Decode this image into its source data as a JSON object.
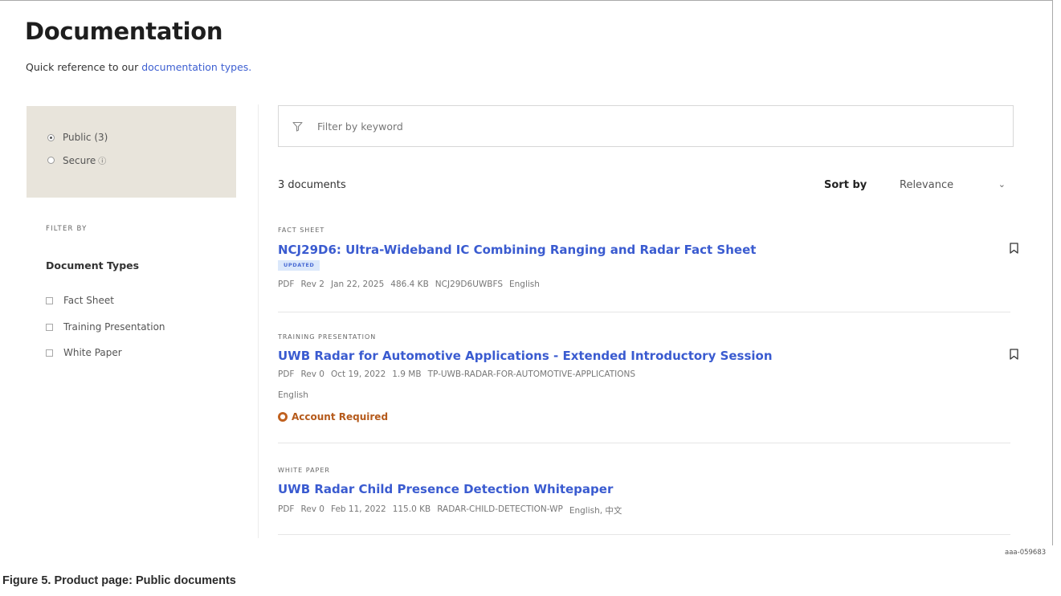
{
  "header": {
    "title": "Documentation",
    "intro_prefix": "Quick reference to our ",
    "intro_link": "documentation types."
  },
  "access": {
    "options": [
      {
        "label": "Public (3)",
        "selected": true
      },
      {
        "label": "Secure",
        "selected": false,
        "icon": "info-icon"
      }
    ]
  },
  "filters": {
    "filter_by_label": "FILTER BY",
    "doc_types_heading": "Document Types",
    "doc_types": [
      "Fact Sheet",
      "Training Presentation",
      "White Paper"
    ]
  },
  "search": {
    "placeholder": "Filter by keyword",
    "icon": "funnel-icon"
  },
  "results": {
    "count_label": "3 documents",
    "sort_label": "Sort by",
    "sort_value": "Relevance"
  },
  "documents": [
    {
      "type": "FACT SHEET",
      "title": "NCJ29D6: Ultra-Wideband IC Combining Ranging and Radar Fact Sheet",
      "badge": "UPDATED",
      "format": "PDF",
      "rev": "Rev 2",
      "date": "Jan 22, 2025",
      "size": "486.4 KB",
      "code": "NCJ29D6UWBFS",
      "language": "English",
      "bookmark_icon": "bookmark-icon"
    },
    {
      "type": "TRAINING PRESENTATION",
      "title": "UWB Radar for Automotive Applications - Extended Introductory Session",
      "format": "PDF",
      "rev": "Rev 0",
      "date": "Oct 19, 2022",
      "size": "1.9 MB",
      "code": "TP-UWB-RADAR-FOR-AUTOMOTIVE-APPLICATIONS",
      "language": "English",
      "account_required": "Account Required",
      "account_icon": "lock-icon",
      "bookmark_icon": "bookmark-icon"
    },
    {
      "type": "WHITE PAPER",
      "title": "UWB Radar Child Presence Detection Whitepaper",
      "format": "PDF",
      "rev": "Rev 0",
      "date": "Feb 11, 2022",
      "size": "115.0 KB",
      "code": "RADAR-CHILD-DETECTION-WP",
      "language": "English, 中文"
    }
  ],
  "figure": {
    "code": "aaa-059683",
    "caption": "Figure 5.  Product page: Public documents"
  },
  "colors": {
    "link": "#3a5bd0",
    "sidebar_bg": "#e8e4db",
    "badge_bg": "#dbe8fb",
    "warning": "#b55a1b"
  }
}
